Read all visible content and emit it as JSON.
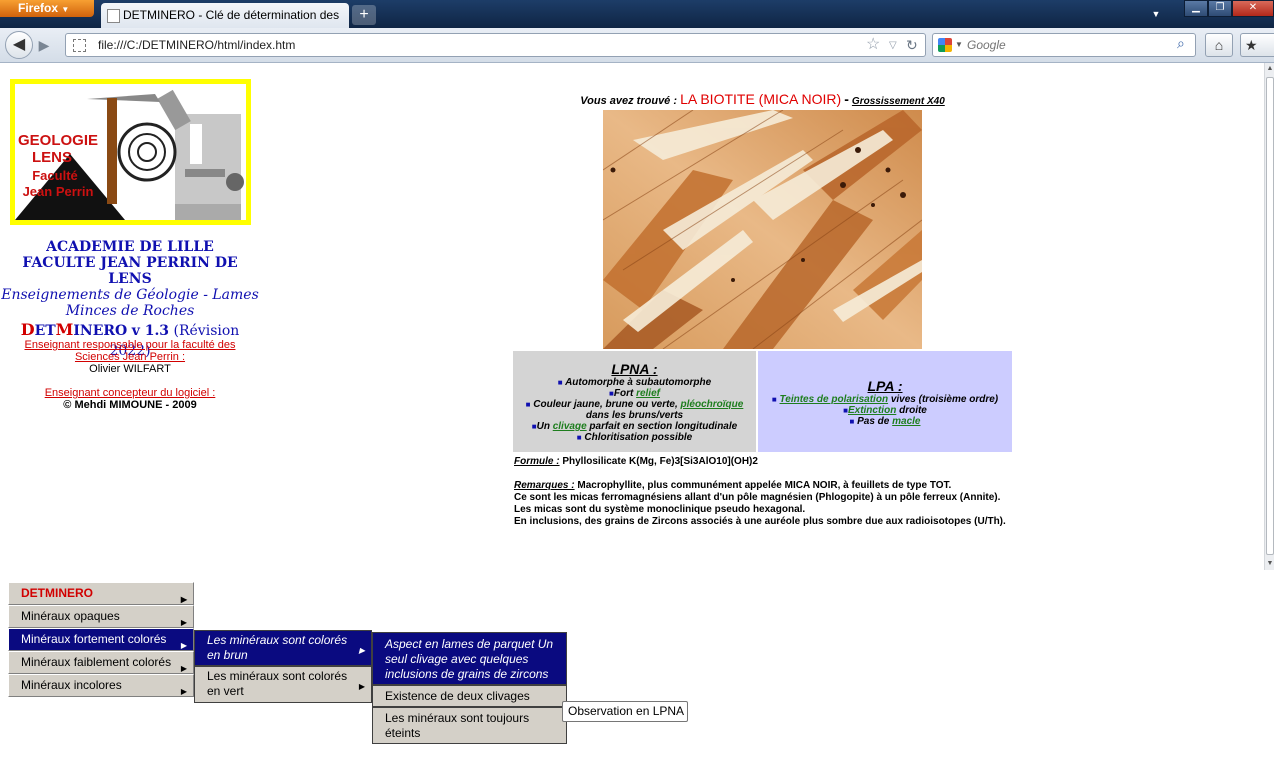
{
  "browser": {
    "app_button": "Firefox",
    "tab_title": "DETMINERO - Clé de détermination des ...",
    "new_tab": "+",
    "url": "file:///C:/DETMINERO/html/index.htm",
    "search_placeholder": "Google"
  },
  "sidebar": {
    "logo": {
      "line1": "GEOLOGIE",
      "line2": "LENS",
      "line3": "Faculté",
      "line4": "Jean Perrin"
    },
    "academy": "ACADEMIE DE LILLE",
    "faculty": "FACULTE JEAN PERRIN DE LENS",
    "teaching1": "Enseignements de Géologie - Lames",
    "teaching2": "Minces de Roches",
    "app_d": "D",
    "app_et": "ET",
    "app_m": "M",
    "app_rest": "INERO",
    "app_version": "v 1.3",
    "app_revision": "(Révision 2022)",
    "resp_label": "Enseignant responsable pour la faculté des Sciences Jean Perrin :",
    "resp_name": "Olivier WILFART",
    "designer_label": "Enseignant concepteur du logiciel :",
    "designer_name": "© Mehdi MIMOUNE - 2009"
  },
  "main": {
    "found_label": "Vous avez trouvé :",
    "mineral": "LA BIOTITE (MICA NOIR)",
    "dash": "-",
    "zoom": "Grossissement X40",
    "lpna": {
      "title": "LPNA :",
      "l1": "Automorphe à subautomorphe",
      "l2_pre": "Fort ",
      "l2_link": "relief",
      "l3_pre": "Couleur jaune, brune ou verte, ",
      "l3_link": "pléochroïque",
      "l3_post": "dans les bruns/verts",
      "l4_pre": "Un ",
      "l4_link": "clivage",
      "l4_post": " parfait en section longitudinale",
      "l5": "Chloritisation possible"
    },
    "lpa": {
      "title": "LPA :",
      "l1_link": "Teintes de polarisation",
      "l1_post": " vives (troisième ordre)",
      "l2_link": "Extinction",
      "l2_post": " droite",
      "l3_pre": "Pas de ",
      "l3_link": "macle"
    },
    "formula_label": "Formule :",
    "formula": "Phyllosilicate K(Mg, Fe)3[Si3AlO10](OH)2",
    "remarks_label": "Remarques :",
    "r1": "Macrophyllite, plus communément appelée MICA NOIR, à feuillets de type TOT.",
    "r2": "Ce sont les micas ferromagnésiens allant d'un pôle magnésien (Phlogopite) à un pôle ferreux (Annite).",
    "r3": "Les micas sont du système monoclinique pseudo hexagonal.",
    "r4": "En inclusions, des grains de Zircons associés à une auréole plus sombre due aux radioisotopes (U/Th)."
  },
  "menu": {
    "m1": "DETMINERO",
    "m2": "Minéraux opaques",
    "m3": "Minéraux fortement colorés",
    "m4": "Minéraux faiblement colorés",
    "m5": "Minéraux incolores",
    "s1": "Les minéraux sont colorés en brun",
    "s2": "Les minéraux sont colorés en vert",
    "t1": "Aspect en lames de parquet Un seul clivage avec quelques inclusions de grains de zircons",
    "t2": "Existence de deux clivages",
    "t3": "Les minéraux sont toujours éteints",
    "tooltip": "Observation en LPNA"
  },
  "colors": {
    "menu_selected": "#0a0a80",
    "accent_red": "#d10000",
    "academy_blue": "#1010b0",
    "lpa_bg": "#ccccff",
    "lpna_bg": "#d4d4d4"
  }
}
